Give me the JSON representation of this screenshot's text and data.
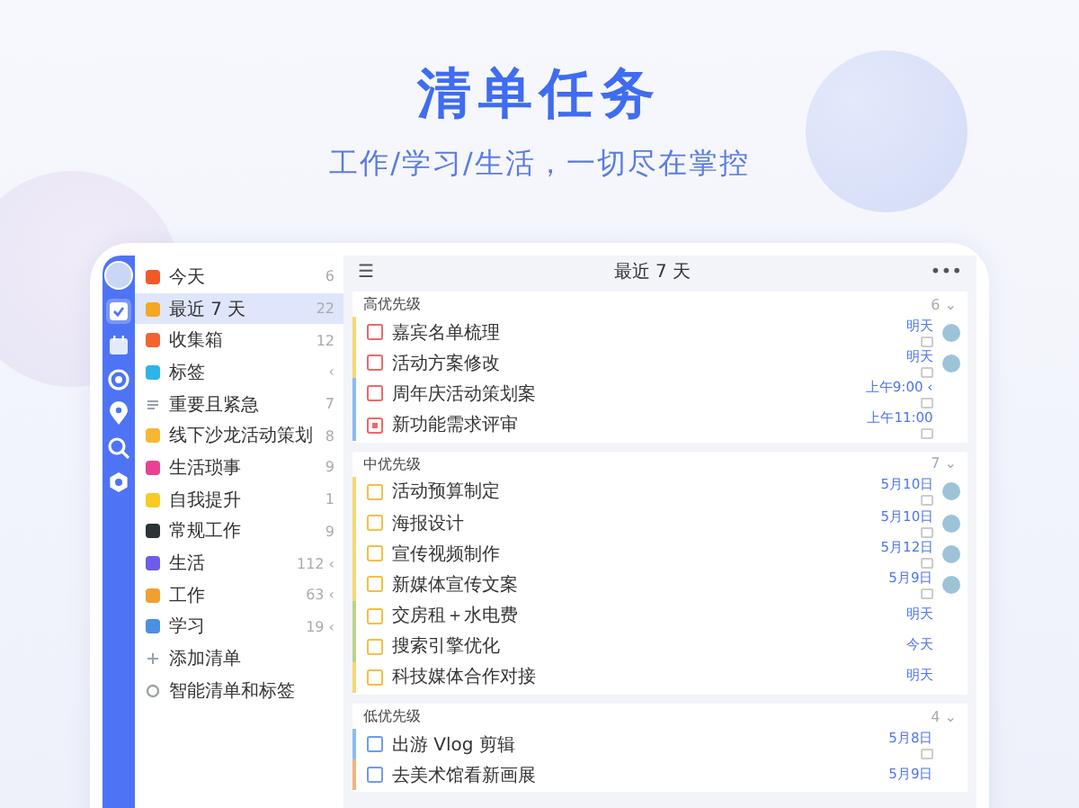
{
  "title": "清单任务",
  "subtitle": "工作/学习/生活，一切尽在掌控",
  "rail": [
    {
      "kind": "avatar",
      "selected": false
    },
    {
      "kind": "tasks",
      "selected": true
    },
    {
      "kind": "calendar",
      "selected": false
    },
    {
      "kind": "focus",
      "selected": false
    },
    {
      "kind": "pin",
      "selected": false
    },
    {
      "kind": "search",
      "selected": false
    },
    {
      "kind": "settings",
      "selected": false
    }
  ],
  "sidebar": {
    "items": [
      {
        "label": "今天",
        "count": "6",
        "color": "#f05a28",
        "kind": "list",
        "selected": false
      },
      {
        "label": "最近 7 天",
        "count": "22",
        "color": "#f5a623",
        "kind": "list",
        "selected": true
      },
      {
        "label": "收集箱",
        "count": "12",
        "color": "#f06432",
        "kind": "list",
        "selected": false
      },
      {
        "label": "标签",
        "count": "‹",
        "color": "#2fb4e8",
        "kind": "list",
        "selected": false
      },
      {
        "label": "重要且紧急",
        "count": "7",
        "color": "#9aa0ad",
        "kind": "lines",
        "selected": false
      },
      {
        "label": "线下沙龙活动策划",
        "count": "8",
        "color": "#f7b731",
        "kind": "list",
        "selected": false
      },
      {
        "label": "生活琐事",
        "count": "9",
        "color": "#e84393",
        "kind": "list",
        "selected": false
      },
      {
        "label": "自我提升",
        "count": "1",
        "color": "#f9ca24",
        "kind": "list",
        "selected": false
      },
      {
        "label": "常规工作",
        "count": "9",
        "color": "#2d3436",
        "kind": "list",
        "selected": false
      },
      {
        "label": "生活",
        "count": "112 ‹",
        "color": "#6c5ce7",
        "kind": "list",
        "selected": false
      },
      {
        "label": "工作",
        "count": "63 ‹",
        "color": "#f0a030",
        "kind": "list",
        "selected": false
      },
      {
        "label": "学习",
        "count": "19 ‹",
        "color": "#4a90e2",
        "kind": "list",
        "selected": false
      },
      {
        "label": "添加清单",
        "color": "#9aa0ad",
        "kind": "add",
        "selected": false
      },
      {
        "label": "智能清单和标签",
        "color": "#9aa0ad",
        "kind": "gear",
        "selected": false
      }
    ]
  },
  "main": {
    "title": "最近 7 天",
    "menu_icon": "☰",
    "more_icon": "•••",
    "sections": [
      {
        "label": "高优先级",
        "count": "6 ⌄",
        "color": "#f0676a",
        "tasks": [
          {
            "title": "嘉宾名单梳理",
            "due": "明天",
            "color": "#f7d774",
            "note": true,
            "assigned": true,
            "subtasks": false
          },
          {
            "title": "活动方案修改",
            "due": "明天",
            "color": "#f7d774",
            "note": true,
            "assigned": true,
            "subtasks": false
          },
          {
            "title": "周年庆活动策划案",
            "due": "上午9:00 ‹",
            "color": "#8bbcf0",
            "note": true,
            "assigned": false,
            "subtasks": false
          },
          {
            "title": "新功能需求评审",
            "due": "上午11:00",
            "color": "#8bbcf0",
            "note": true,
            "assigned": false,
            "subtasks": true
          }
        ]
      },
      {
        "label": "中优先级",
        "count": "7 ⌄",
        "color": "#f5bf42",
        "tasks": [
          {
            "title": "活动预算制定",
            "due": "5月10日",
            "color": "#f7d774",
            "note": true,
            "assigned": true,
            "subtasks": false
          },
          {
            "title": "海报设计",
            "due": "5月10日",
            "color": "#f7d774",
            "note": true,
            "assigned": true,
            "subtasks": false
          },
          {
            "title": "宣传视频制作",
            "due": "5月12日",
            "color": "#f7d774",
            "note": true,
            "assigned": true,
            "subtasks": false
          },
          {
            "title": "新媒体宣传文案",
            "due": "5月9日",
            "color": "#f7d774",
            "note": true,
            "assigned": true,
            "subtasks": false
          },
          {
            "title": "交房租＋水电费",
            "due": "明天",
            "color": "#b9d48a",
            "note": false,
            "assigned": false,
            "subtasks": false
          },
          {
            "title": "搜索引擎优化",
            "due": "今天",
            "color": "#b9d48a",
            "note": false,
            "assigned": false,
            "subtasks": false
          },
          {
            "title": "科技媒体合作对接",
            "due": "明天",
            "color": "#f7d774",
            "note": false,
            "assigned": false,
            "subtasks": false
          }
        ]
      },
      {
        "label": "低优先级",
        "count": "4 ⌄",
        "color": "#6f9bf0",
        "tasks": [
          {
            "title": "出游 Vlog 剪辑",
            "due": "5月8日",
            "color": "#8bbcf0",
            "note": true,
            "assigned": false,
            "subtasks": false
          },
          {
            "title": "去美术馆看新画展",
            "due": "5月9日",
            "color": "#f5b27a",
            "note": false,
            "assigned": false,
            "subtasks": false
          }
        ]
      }
    ]
  }
}
